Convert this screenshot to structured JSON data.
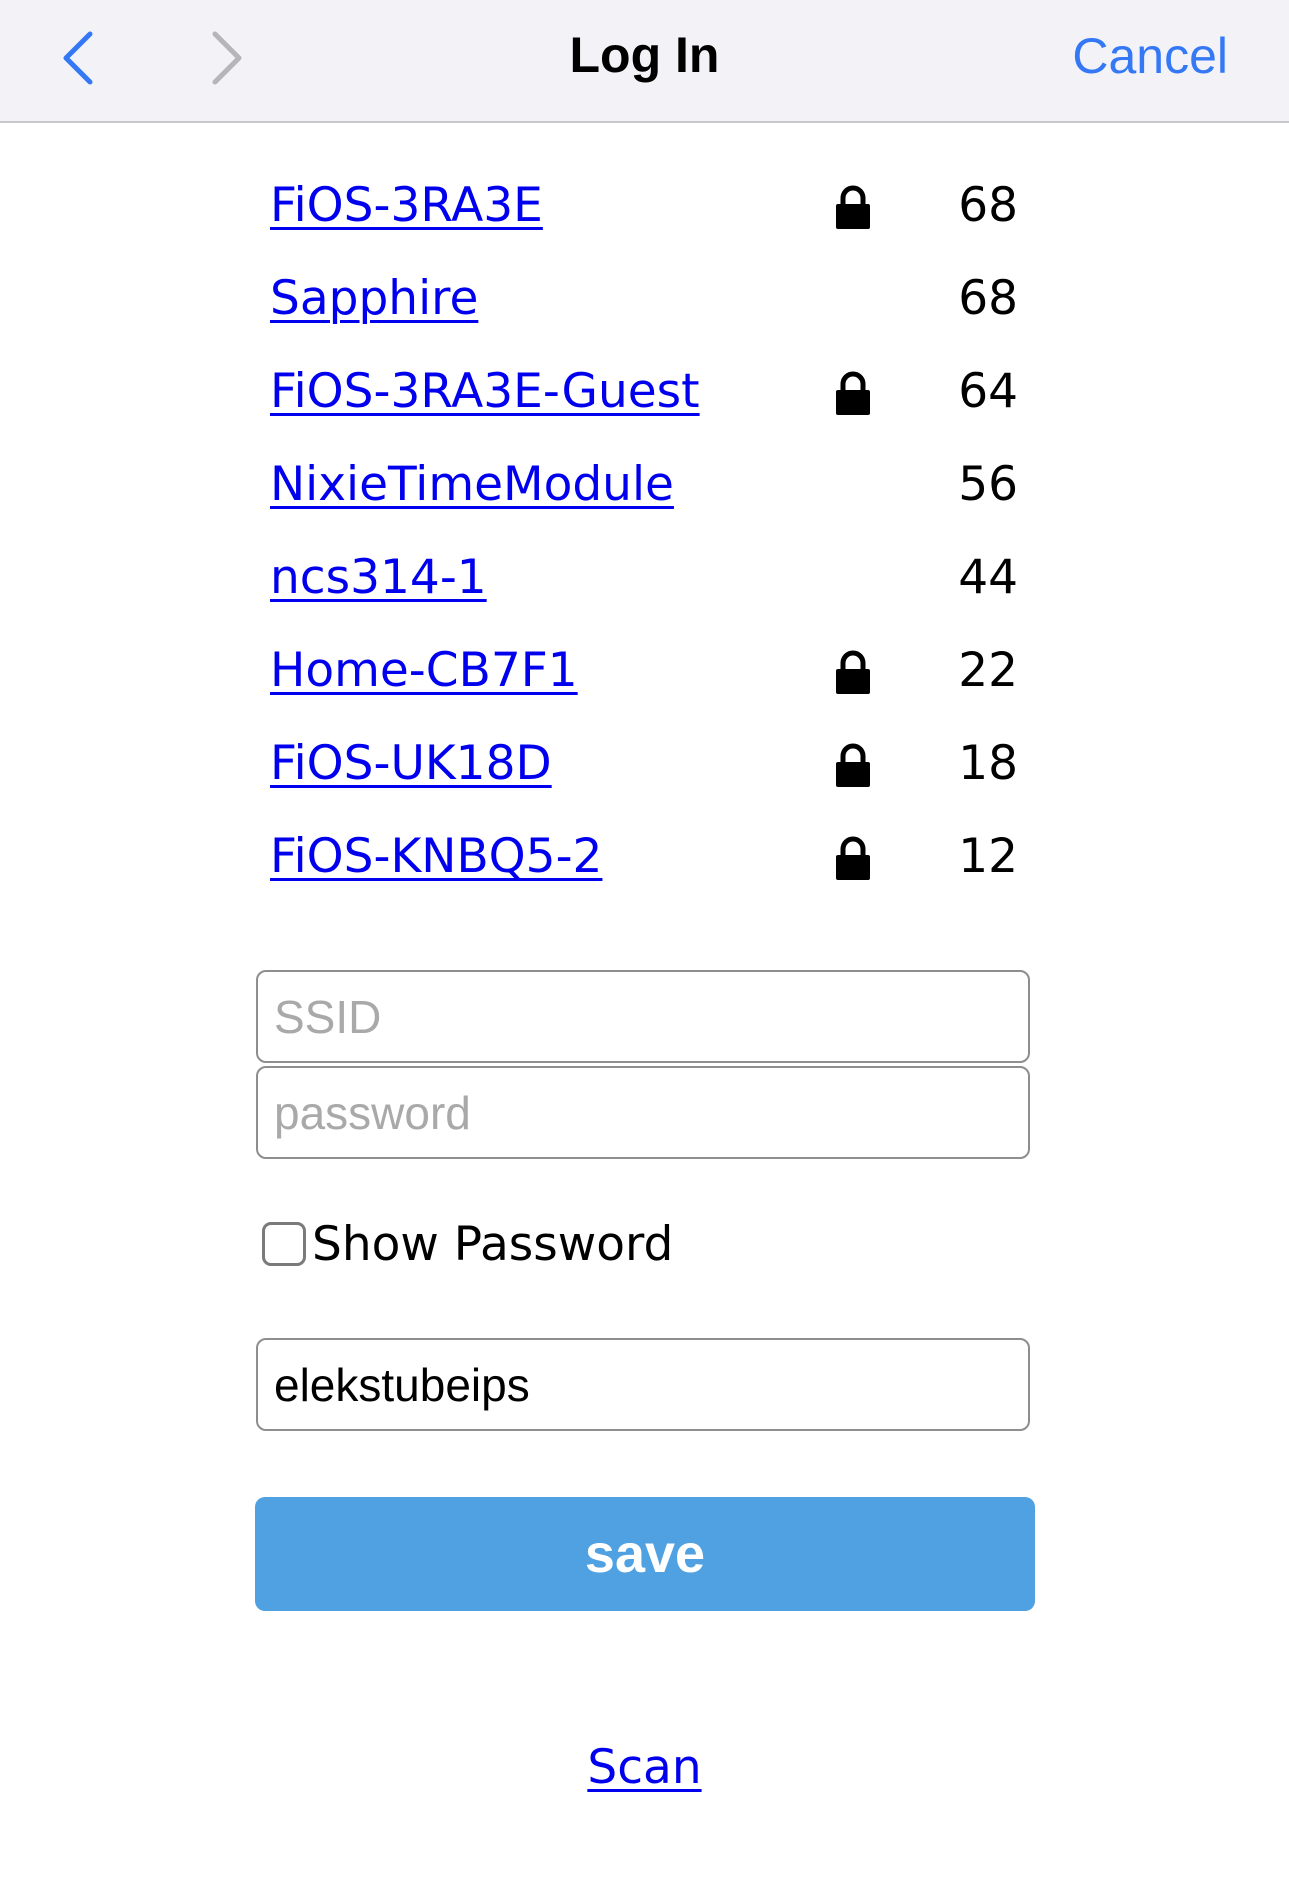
{
  "navbar": {
    "title": "Log In",
    "cancel_label": "Cancel",
    "back_icon": "chevron-left-icon",
    "forward_icon": "chevron-right-icon",
    "accent_color": "#3478f6"
  },
  "networks": [
    {
      "ssid": "FiOS-3RA3E",
      "secured": true,
      "signal": "68"
    },
    {
      "ssid": "Sapphire",
      "secured": false,
      "signal": "68"
    },
    {
      "ssid": "FiOS-3RA3E-Guest",
      "secured": true,
      "signal": "64"
    },
    {
      "ssid": "NixieTimeModule",
      "secured": false,
      "signal": "56"
    },
    {
      "ssid": "ncs314-1",
      "secured": false,
      "signal": "44"
    },
    {
      "ssid": "Home-CB7F1",
      "secured": true,
      "signal": "22"
    },
    {
      "ssid": "FiOS-UK18D",
      "secured": true,
      "signal": "18"
    },
    {
      "ssid": "FiOS-KNBQ5-2",
      "secured": true,
      "signal": "12"
    }
  ],
  "form": {
    "ssid_placeholder": "SSID",
    "password_placeholder": "password",
    "show_password_label": "Show Password",
    "show_password_checked": false,
    "hostname_value": "elekstubeips",
    "save_label": "save",
    "save_color": "#4fa1e2"
  },
  "footer": {
    "scan_label": "Scan"
  }
}
